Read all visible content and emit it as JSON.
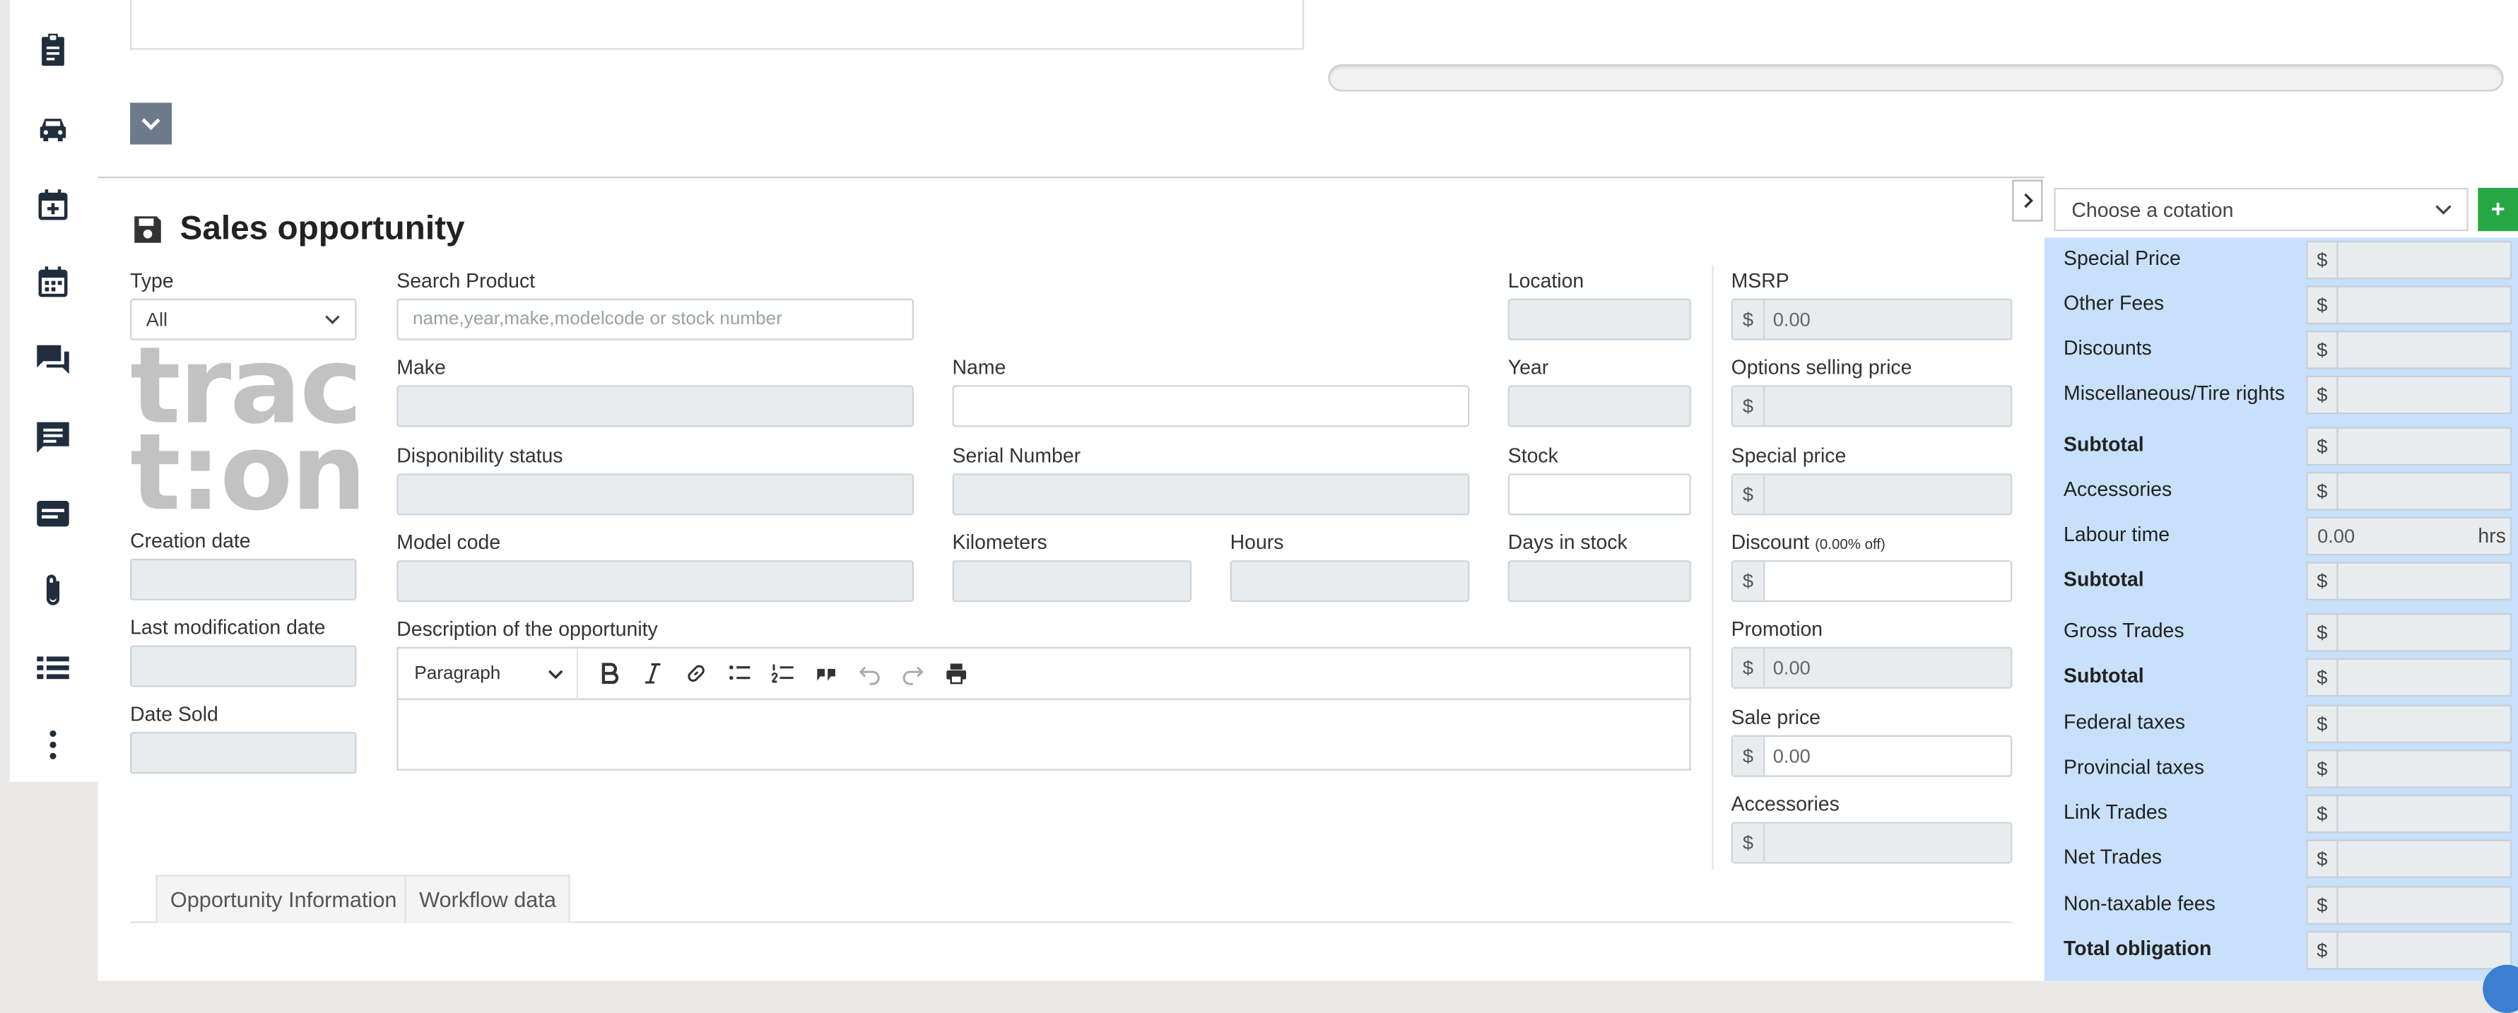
{
  "sidebar": {
    "items": [
      {
        "icon": "clipboard-icon"
      },
      {
        "icon": "car-icon"
      },
      {
        "icon": "calendar-plus-icon"
      },
      {
        "icon": "calendar-icon"
      },
      {
        "icon": "chat-bubbles-icon"
      },
      {
        "icon": "comment-list-icon"
      },
      {
        "icon": "card-icon"
      },
      {
        "icon": "paperclip-icon"
      },
      {
        "icon": "list-icon"
      },
      {
        "icon": "more-vertical-icon"
      }
    ]
  },
  "section": {
    "title": "Sales opportunity",
    "icon": "save-icon"
  },
  "logo": {
    "line1": "trac",
    "line2": "t:on"
  },
  "form": {
    "type_label": "Type",
    "type_value": "All",
    "search_label": "Search Product",
    "search_placeholder": "name,year,make,modelcode or stock number",
    "location_label": "Location",
    "make_label": "Make",
    "name_label": "Name",
    "year_label": "Year",
    "disponibility_label": "Disponibility status",
    "serial_label": "Serial Number",
    "stock_label": "Stock",
    "creation_label": "Creation date",
    "model_label": "Model code",
    "kilometers_label": "Kilometers",
    "hours_label": "Hours",
    "days_label": "Days in stock",
    "lastmod_label": "Last modification date",
    "description_label": "Description of the opportunity",
    "datesold_label": "Date Sold"
  },
  "editor": {
    "paragraph": "Paragraph",
    "tools": [
      "bold-icon",
      "italic-icon",
      "link-icon",
      "bulleted-list-icon",
      "numbered-list-icon",
      "quote-icon",
      "undo-icon",
      "redo-icon",
      "print-icon"
    ]
  },
  "pricing": {
    "currency": "$",
    "msrp_label": "MSRP",
    "msrp_value": "0.00",
    "options_label": "Options selling price",
    "special_label": "Special price",
    "discount_label": "Discount",
    "discount_note": "(0.00% off)",
    "promotion_label": "Promotion",
    "promotion_value": "0.00",
    "sale_label": "Sale price",
    "sale_value": "0.00",
    "accessories_label": "Accessories"
  },
  "tabs": [
    "Opportunity Information",
    "Workflow data"
  ],
  "cotation": {
    "placeholder": "Choose a cotation",
    "add": "+",
    "rows": [
      {
        "label": "Special Price",
        "bold": false,
        "cur": "$",
        "value": "",
        "unit": ""
      },
      {
        "label": "Other Fees",
        "bold": false,
        "cur": "$",
        "value": "",
        "unit": ""
      },
      {
        "label": "Discounts",
        "bold": false,
        "cur": "$",
        "value": "",
        "unit": ""
      },
      {
        "label": "Miscellaneous/Tire rights",
        "bold": false,
        "cur": "$",
        "value": "",
        "unit": ""
      },
      {
        "label": "Subtotal",
        "bold": true,
        "cur": "$",
        "value": "",
        "unit": ""
      },
      {
        "label": "Accessories",
        "bold": false,
        "cur": "$",
        "value": "",
        "unit": ""
      },
      {
        "label": "Labour time",
        "bold": false,
        "cur": "",
        "value": "0.00",
        "unit": "hrs"
      },
      {
        "label": "Subtotal",
        "bold": true,
        "cur": "$",
        "value": "",
        "unit": ""
      },
      {
        "label": "Gross Trades",
        "bold": false,
        "cur": "$",
        "value": "",
        "unit": ""
      },
      {
        "label": "Subtotal",
        "bold": true,
        "cur": "$",
        "value": "",
        "unit": ""
      },
      {
        "label": "Federal taxes",
        "bold": false,
        "cur": "$",
        "value": "",
        "unit": ""
      },
      {
        "label": "Provincial taxes",
        "bold": false,
        "cur": "$",
        "value": "",
        "unit": ""
      },
      {
        "label": "Link Trades",
        "bold": false,
        "cur": "$",
        "value": "",
        "unit": ""
      },
      {
        "label": "Net Trades",
        "bold": false,
        "cur": "$",
        "value": "",
        "unit": ""
      },
      {
        "label": "Non-taxable fees",
        "bold": false,
        "cur": "$",
        "value": "",
        "unit": ""
      },
      {
        "label": "Total obligation",
        "bold": true,
        "cur": "$",
        "value": "",
        "unit": ""
      }
    ]
  }
}
